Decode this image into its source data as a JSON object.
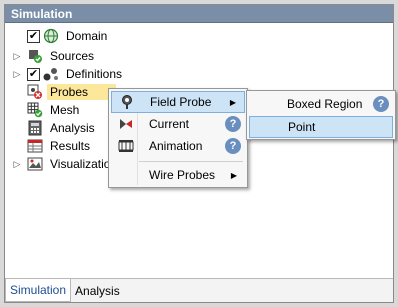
{
  "panel": {
    "title": "Simulation"
  },
  "tree": {
    "domain": {
      "label": "Domain",
      "checked": "✔"
    },
    "sources": {
      "label": "Sources"
    },
    "definitions": {
      "label": "Definitions",
      "checked": "✔"
    },
    "probes": {
      "label": "Probes"
    },
    "mesh": {
      "label": "Mesh"
    },
    "analysis": {
      "label": "Analysis"
    },
    "results": {
      "label": "Results"
    },
    "visualization": {
      "label": "Visualization"
    }
  },
  "tabs": {
    "simulation": "Simulation",
    "analysis": "Analysis"
  },
  "context_menu": {
    "field_probe": "Field Probe",
    "current": "Current",
    "animation": "Animation",
    "wire_probes": "Wire Probes",
    "help_glyph": "?"
  },
  "submenu": {
    "boxed_region": "Boxed Region",
    "point": "Point"
  },
  "icons": {
    "expander": "▷",
    "submenu_arrow": "▶"
  },
  "colors": {
    "title_bar": "#7a8ea8",
    "selection": "#fde79a",
    "highlight": "#cde4f7",
    "help": "#6a8fbf"
  }
}
